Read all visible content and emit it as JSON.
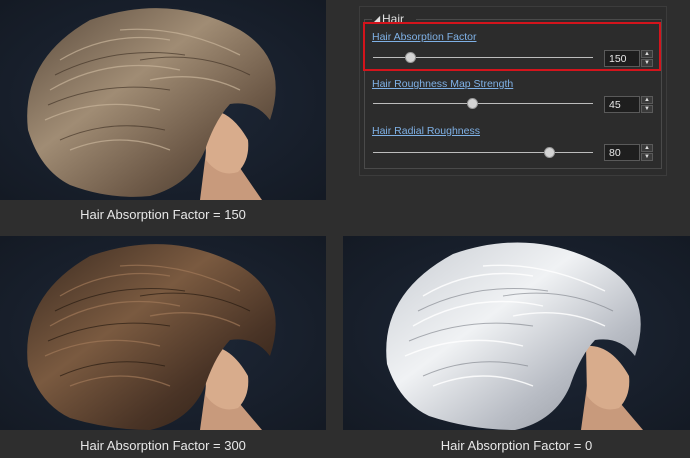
{
  "panel": {
    "section_title": "Hair",
    "params": [
      {
        "label": "Hair Absorption Factor",
        "value": "150",
        "level": 0.17
      },
      {
        "label": "Hair Roughness Map Strength",
        "value": "45",
        "level": 0.45
      },
      {
        "label": "Hair Radial Roughness",
        "value": "80",
        "level": 0.8
      }
    ]
  },
  "captions": {
    "top_left": "Hair Absorption Factor = 150",
    "bottom_left": "Hair Absorption Factor = 300",
    "bottom_right": "Hair Absorption Factor = 0"
  },
  "colors": {
    "highlight": "#d4141c",
    "link": "#7fb1e6",
    "render_background": "#18202c"
  }
}
